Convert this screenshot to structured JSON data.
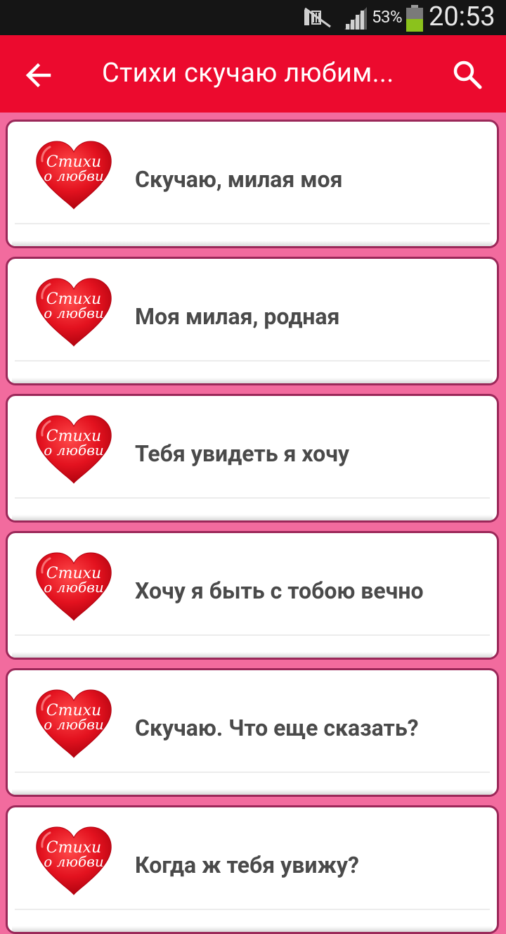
{
  "status_bar": {
    "battery_percent": "53%",
    "time": "20:53",
    "icons": [
      "mute-icon",
      "signal-icon",
      "battery-icon"
    ]
  },
  "app_bar": {
    "title": "Стихи скучаю любим...",
    "back_icon": "arrow-left-icon",
    "search_icon": "search-icon",
    "color": "#ec0a2e"
  },
  "list": {
    "items": [
      {
        "title": "Скучаю, милая моя",
        "badge_line1": "Стихи",
        "badge_line2": "о любви"
      },
      {
        "title": "Моя милая, родная",
        "badge_line1": "Стихи",
        "badge_line2": "о любви"
      },
      {
        "title": "Тебя увидеть я хочу",
        "badge_line1": "Стихи",
        "badge_line2": "о любви"
      },
      {
        "title": "Хочу я быть с тобою вечно",
        "badge_line1": "Стихи",
        "badge_line2": "о любви"
      },
      {
        "title": "Скучаю. Что еще сказать?",
        "badge_line1": "Стихи",
        "badge_line2": "о любви"
      },
      {
        "title": "Когда ж тебя увижу?",
        "badge_line1": "Стихи",
        "badge_line2": "о любви"
      }
    ]
  },
  "colors": {
    "background": "#f26b9e",
    "card_border": "#9b2859",
    "heart": "#e3121f",
    "text": "#4a4a4a"
  }
}
